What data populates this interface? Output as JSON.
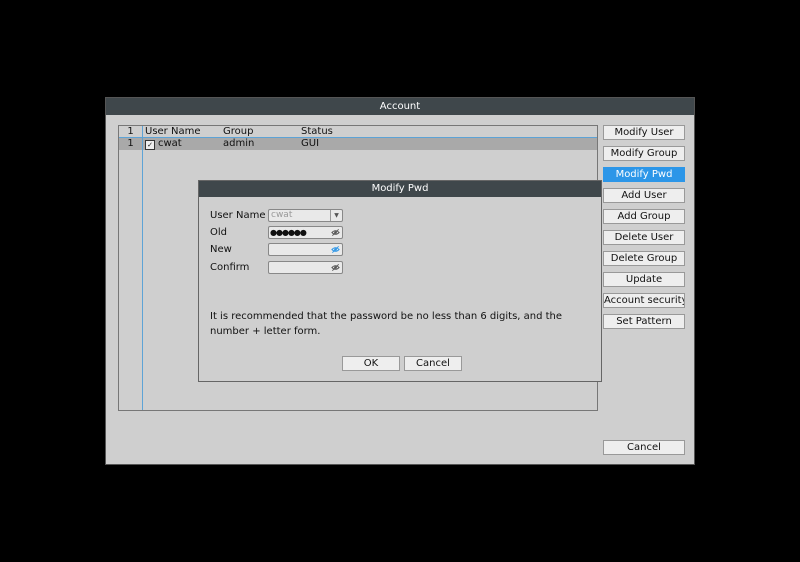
{
  "window": {
    "title": "Account"
  },
  "list": {
    "header": {
      "num": "1",
      "user": "User Name",
      "group": "Group",
      "status": "Status"
    },
    "rows": [
      {
        "num": "1",
        "user": "cwat",
        "group": "admin",
        "status": "GUI",
        "checked": "✓"
      }
    ]
  },
  "side_buttons": {
    "modify_user": "Modify User",
    "modify_group": "Modify Group",
    "modify_pwd": "Modify Pwd",
    "add_user": "Add User",
    "add_group": "Add Group",
    "delete_user": "Delete User",
    "delete_group": "Delete Group",
    "update": "Update",
    "account_security": "Account security",
    "set_pattern": "Set Pattern",
    "cancel": "Cancel"
  },
  "dialog": {
    "title": "Modify Pwd",
    "user_name_label": "User Name",
    "user_name_value": "cwat",
    "old_label": "Old",
    "old_value": "●●●●●●",
    "new_label": "New",
    "new_value": "",
    "confirm_label": "Confirm",
    "confirm_value": "",
    "hint": "It is recommended that the password be no less than 6 digits, and the number + letter form.",
    "ok": "OK",
    "cancel": "Cancel"
  },
  "colors": {
    "titlebar": "#3f474b",
    "accent": "#2c96e8",
    "panel": "#cfcfcf"
  }
}
